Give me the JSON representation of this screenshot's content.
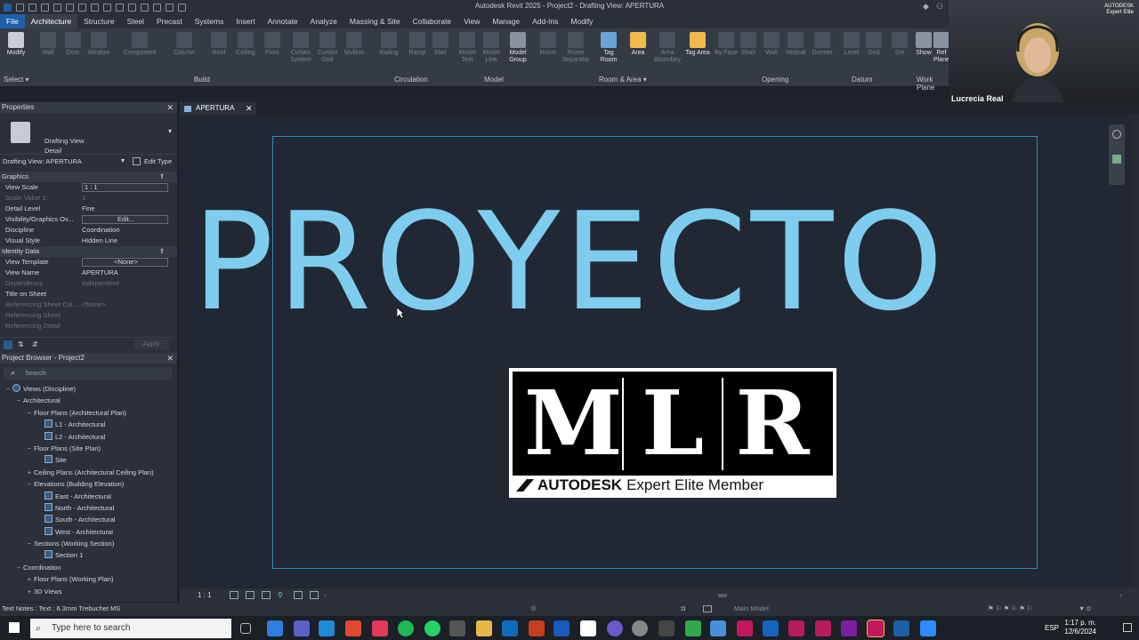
{
  "window": {
    "title": "Autodesk Revit 2025 - Project2 - Drafting View: APERTURA"
  },
  "menu": {
    "items": [
      "File",
      "Architecture",
      "Structure",
      "Steel",
      "Precast",
      "Systems",
      "Insert",
      "Annotate",
      "Analyze",
      "Massing & Site",
      "Collaborate",
      "View",
      "Manage",
      "Add-Ins",
      "Modify"
    ],
    "active": "Architecture"
  },
  "ribbon": {
    "modify_label": "Modify",
    "buttons": [
      "Wall",
      "Door",
      "Window",
      "Component",
      "Column",
      "Roof",
      "Ceiling",
      "Floor",
      "Curtain System",
      "Curtain Grid",
      "Mullion",
      "Railing",
      "Ramp",
      "Stair",
      "Model Text",
      "Model Line",
      "Model Group",
      "Room",
      "Room Separator",
      "Tag Room",
      "Area",
      "Area Boundary",
      "Tag Area",
      "By Face",
      "Shaft",
      "Wall",
      "Vertical",
      "Dormer",
      "Level",
      "Grid",
      "Set",
      "Show",
      "Ref Plane"
    ],
    "panels": [
      "Select",
      "Build",
      "Circulation",
      "Model",
      "Room & Area",
      "Opening",
      "Datum",
      "Work Plane"
    ]
  },
  "webcam": {
    "name": "Lucrecia Real",
    "logo_line1": "AUTODESK",
    "logo_line2": "Expert Elite"
  },
  "properties": {
    "title": "Properties",
    "type_line1": "Drafting View",
    "type_line2": "Detail",
    "selector": "Drafting View: APERTURA",
    "edit_type": "Edit Type",
    "sections": {
      "graphics": "Graphics",
      "identity": "Identity Data"
    },
    "rows_graphics": [
      {
        "k": "View Scale",
        "v": "1 : 1",
        "dim": false,
        "box": true
      },
      {
        "k": "Scale Value    1:",
        "v": "1",
        "dim": true,
        "box": false
      },
      {
        "k": "Detail Level",
        "v": "Fine",
        "dim": false,
        "box": false
      },
      {
        "k": "Visibility/Graphics Ov...",
        "v": "Edit...",
        "dim": false,
        "box": true
      },
      {
        "k": "Discipline",
        "v": "Coordination",
        "dim": false,
        "box": false
      },
      {
        "k": "Visual Style",
        "v": "Hidden Line",
        "dim": false,
        "box": false
      }
    ],
    "rows_identity": [
      {
        "k": "View Template",
        "v": "<None>",
        "dim": false,
        "box": true
      },
      {
        "k": "View Name",
        "v": "APERTURA",
        "dim": false,
        "box": false
      },
      {
        "k": "Dependency",
        "v": "Independent",
        "dim": true,
        "box": false
      },
      {
        "k": "Title on Sheet",
        "v": "",
        "dim": false,
        "box": false
      },
      {
        "k": "Referencing Sheet Col...",
        "v": "<None>",
        "dim": true,
        "box": false
      },
      {
        "k": "Referencing Sheet",
        "v": "",
        "dim": true,
        "box": false
      },
      {
        "k": "Referencing Detail",
        "v": "",
        "dim": true,
        "box": false
      }
    ],
    "apply": "Apply"
  },
  "browser": {
    "title": "Project Browser - Project2",
    "search_placeholder": "Search",
    "items": [
      {
        "label": "Views (Discipline)",
        "indent": 0,
        "toggle": "−",
        "view": false
      },
      {
        "label": "Architectural",
        "indent": 1,
        "toggle": "−",
        "view": false
      },
      {
        "label": "Floor Plans (Architectural Plan)",
        "indent": 2,
        "toggle": "−",
        "view": false
      },
      {
        "label": "L1 - Architectural",
        "indent": 3,
        "toggle": "",
        "view": true
      },
      {
        "label": "L2 - Architectural",
        "indent": 3,
        "toggle": "",
        "view": true
      },
      {
        "label": "Floor Plans (Site Plan)",
        "indent": 2,
        "toggle": "−",
        "view": false
      },
      {
        "label": "Site",
        "indent": 3,
        "toggle": "",
        "view": true
      },
      {
        "label": "Ceiling Plans (Architectural Ceiling Plan)",
        "indent": 2,
        "toggle": "+",
        "view": false
      },
      {
        "label": "Elevations (Building Elevation)",
        "indent": 2,
        "toggle": "−",
        "view": false
      },
      {
        "label": "East - Architectural",
        "indent": 3,
        "toggle": "",
        "view": true
      },
      {
        "label": "North - Architectural",
        "indent": 3,
        "toggle": "",
        "view": true
      },
      {
        "label": "South - Architectural",
        "indent": 3,
        "toggle": "",
        "view": true
      },
      {
        "label": "West - Architectural",
        "indent": 3,
        "toggle": "",
        "view": true
      },
      {
        "label": "Sections (Working Section)",
        "indent": 2,
        "toggle": "−",
        "view": false
      },
      {
        "label": "Section 1",
        "indent": 3,
        "toggle": "",
        "view": true
      },
      {
        "label": "Coordination",
        "indent": 1,
        "toggle": "−",
        "view": false
      },
      {
        "label": "Floor Plans (Working Plan)",
        "indent": 2,
        "toggle": "+",
        "view": false
      },
      {
        "label": "3D Views",
        "indent": 2,
        "toggle": "+",
        "view": false
      }
    ]
  },
  "view_tab": {
    "label": "APERTURA"
  },
  "canvas": {
    "title_text": "PROYECTO",
    "title_color": "#7fcdee",
    "frame_color": "#2d8fb8",
    "logo": {
      "l1": "M",
      "l2": "L",
      "l3": "R",
      "tag_bold": "AUTODESK",
      "tag_rest": "Expert Elite Member"
    }
  },
  "view_control": {
    "scale": "1 : 1",
    "model": "Main Model",
    "zero": ":0"
  },
  "status": {
    "text": "Text Notes : Text : 6.3mm Trebuchet MS"
  },
  "taskbar": {
    "search_placeholder": "Type here to search",
    "time": "1:17 p. m.",
    "date": "12/6/2024",
    "lang": "ESP"
  }
}
